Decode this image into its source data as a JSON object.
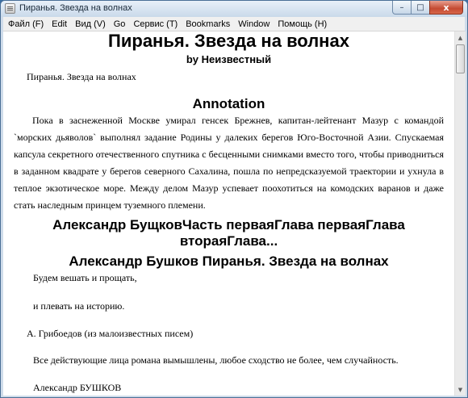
{
  "window": {
    "title": "Пиранья. Звезда на волнах",
    "buttons": {
      "minimize": "–",
      "maximize": "□",
      "close": "x"
    }
  },
  "menu": [
    "Файл (F)",
    "Edit",
    "Вид (V)",
    "Go",
    "Сервис (T)",
    "Bookmarks",
    "Window",
    "Помощь (H)"
  ],
  "document": {
    "title": "Пиранья. Звезда на волнах",
    "byline": "by Неизвестный",
    "subtitle_line": "Пиранья. Звезда на волнах",
    "annotation_heading": "Annotation",
    "annotation_text": "Пока в заснеженной Москве умирал генсек Брежнев, капитан-лейтенант Мазур с командой `морских дьяволов` выполнял задание Родины у далеких берегов Юго-Восточной Азии. Спускаемая капсула секретного отечественного спутника с бесценными снимками вместо того, чтобы приводниться в заданном квадрате у берегов северного Сахалина, пошла по непредсказуемой траектории и ухнула в теплое экзотическое море. Между делом Мазур успевает поохотиться на комодских варанов и даже стать наследным принцем туземного племени.",
    "chapter_heading_line1": "Александр БущковЧасть перваяГлава перваяГлава",
    "chapter_heading_line2": "втораяГлава...",
    "section_heading": "Александр Бушков Пиранья. Звезда на волнах",
    "epigraph_line1": "Будем вешать и прощать,",
    "epigraph_line2": "и плевать на историю.",
    "epigraph_attribution": "А. Грибоедов (из малоизвестных писем)",
    "disclaimer": "Все действующие лица романа вымышлены, любое сходство не более, чем случайность.",
    "author_signature": "Александр БУШКОВ"
  }
}
